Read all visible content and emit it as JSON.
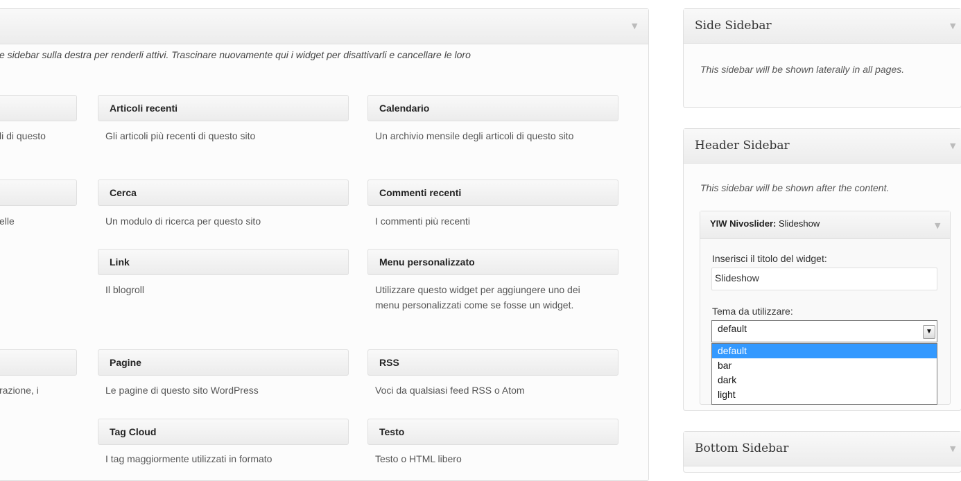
{
  "available": {
    "intro_text": "e sidebar sulla destra per renderli attivi. Trascinare nuovamente qui i widget per disattivarli e cancellare le loro",
    "partial_descs": [
      "li di questo",
      "elle",
      "razione, i"
    ],
    "widgets": [
      {
        "title": "Articoli recenti",
        "desc": "Gli articoli più recenti di questo sito"
      },
      {
        "title": "Calendario",
        "desc": "Un archivio mensile degli articoli di questo sito"
      },
      {
        "title": "Cerca",
        "desc": "Un modulo di ricerca per questo sito"
      },
      {
        "title": "Commenti recenti",
        "desc": "I commenti più recenti"
      },
      {
        "title": "Link",
        "desc": "Il blogroll"
      },
      {
        "title": "Menu personalizzato",
        "desc": "Utilizzare questo widget per aggiungere uno dei menu personalizzati come se fosse un widget."
      },
      {
        "title": "Pagine",
        "desc": "Le pagine di questo sito WordPress"
      },
      {
        "title": "RSS",
        "desc": "Voci da qualsiasi feed RSS o Atom"
      },
      {
        "title": "Tag Cloud",
        "desc": "I tag maggiormente utilizzati in formato"
      },
      {
        "title": "Testo",
        "desc": "Testo o HTML libero"
      }
    ]
  },
  "sidebars": {
    "side": {
      "title": "Side Sidebar",
      "desc": "This sidebar will be shown laterally in all pages."
    },
    "header": {
      "title": "Header Sidebar",
      "desc": "This sidebar will be shown after the content."
    },
    "bottom": {
      "title": "Bottom Sidebar"
    }
  },
  "slider_widget": {
    "title_bold": "YIW Nivoslider:",
    "title_rest": " Slideshow",
    "title_label": "Inserisci il titolo del widget:",
    "title_value": "Slideshow",
    "theme_label": "Tema da utilizzare:",
    "theme_selected": "default",
    "theme_options": [
      "default",
      "bar",
      "dark",
      "light"
    ]
  },
  "icons": {
    "collapse": "triangle-down-icon",
    "select_arrow": "chevron-down-icon"
  },
  "colors": {
    "selected_option": "#3399ff",
    "panel_border": "#dfdfdf"
  }
}
